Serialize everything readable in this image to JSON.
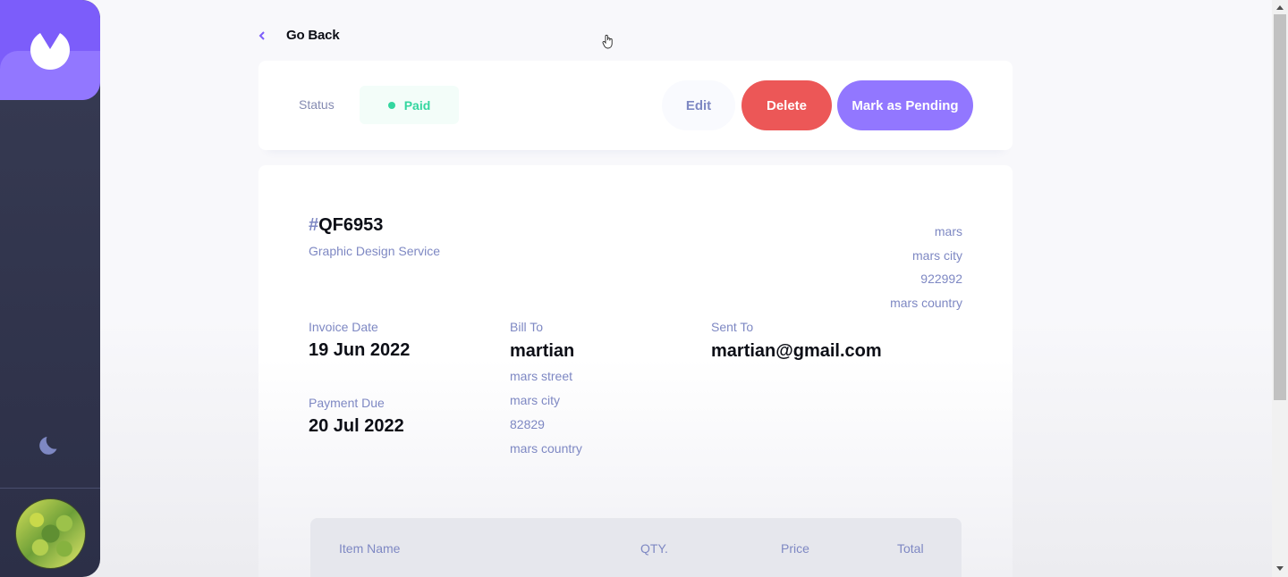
{
  "sidebar": {
    "logo_icon": "app-logo-icon",
    "theme_icon": "moon-icon",
    "avatar_icon": "user-avatar"
  },
  "nav": {
    "go_back_label": "Go Back",
    "go_back_icon": "chevron-left-icon"
  },
  "status_bar": {
    "status_label": "Status",
    "status_value": "Paid",
    "edit_label": "Edit",
    "delete_label": "Delete",
    "mark_label": "Mark as Pending"
  },
  "invoice": {
    "hash": "#",
    "id": "QF6953",
    "description": "Graphic Design Service",
    "sender_address": {
      "street": "mars",
      "city": "mars city",
      "post_code": "922992",
      "country": "mars country"
    },
    "invoice_date_label": "Invoice Date",
    "invoice_date": "19 Jun 2022",
    "payment_due_label": "Payment Due",
    "payment_due": "20 Jul 2022",
    "bill_to_label": "Bill To",
    "client_name": "martian",
    "client_address": {
      "street": "mars street",
      "city": "mars city",
      "post_code": "82829",
      "country": "mars country"
    },
    "sent_to_label": "Sent To",
    "client_email": "martian@gmail.com",
    "items_header": {
      "name": "Item Name",
      "qty": "QTY.",
      "price": "Price",
      "total": "Total"
    }
  },
  "colors": {
    "accent": "#7c5dfa",
    "accent_light": "#9277ff",
    "danger": "#ec5757",
    "paid": "#33d69f",
    "sidebar": "#373b53"
  }
}
